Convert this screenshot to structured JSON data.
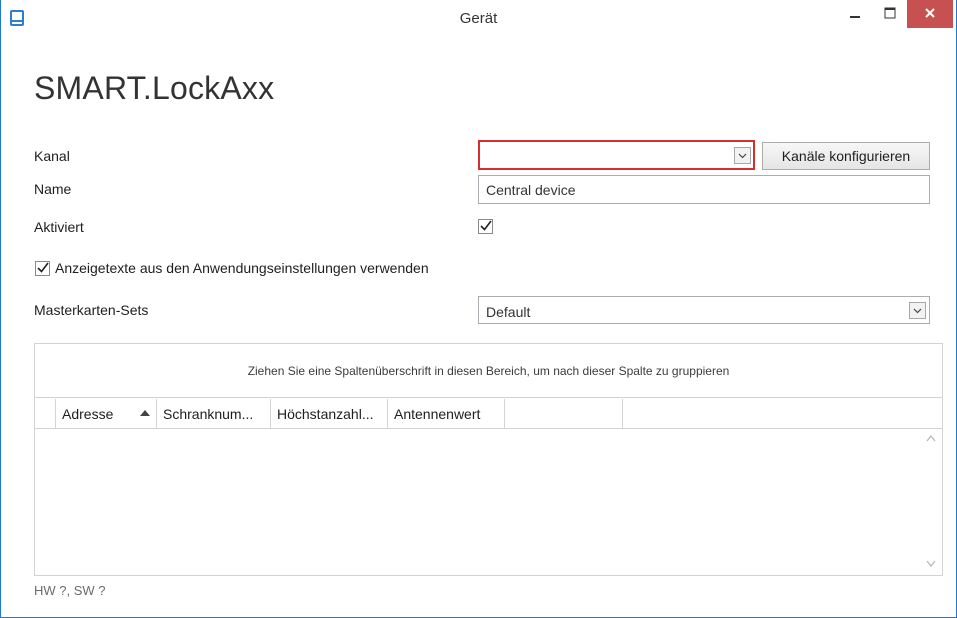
{
  "window": {
    "title": "Gerät",
    "accent_color": "#1e7ad0",
    "close_color": "#c75050",
    "icons": {
      "app": "device-icon",
      "minimize": "minimize-icon",
      "maximize": "maximize-icon",
      "close": "close-icon"
    }
  },
  "heading": "SMART.LockAxx",
  "form": {
    "kanal_label": "Kanal",
    "kanal_value": "",
    "kanal_invalid_color": "#d52f2f",
    "configure_button": "Kanäle konfigurieren",
    "name_label": "Name",
    "name_value": "Central device",
    "aktiviert_label": "Aktiviert",
    "aktiviert_checked": true,
    "use_app_texts_label": "Anzeigetexte aus den Anwendungseinstellungen verwenden",
    "use_app_texts_checked": true,
    "masterkarten_label": "Masterkarten-Sets",
    "masterkarten_value": "Default"
  },
  "grid": {
    "group_panel_text": "Ziehen Sie eine Spaltenüberschrift in diesen Bereich, um nach dieser Spalte zu gruppieren",
    "columns": [
      "Adresse",
      "Schranknum...",
      "Höchstanzahl...",
      "Antennenwert"
    ],
    "sorted_column": "Adresse",
    "sort_direction": "ascending",
    "rows": []
  },
  "footer": "HW ?, SW ?"
}
